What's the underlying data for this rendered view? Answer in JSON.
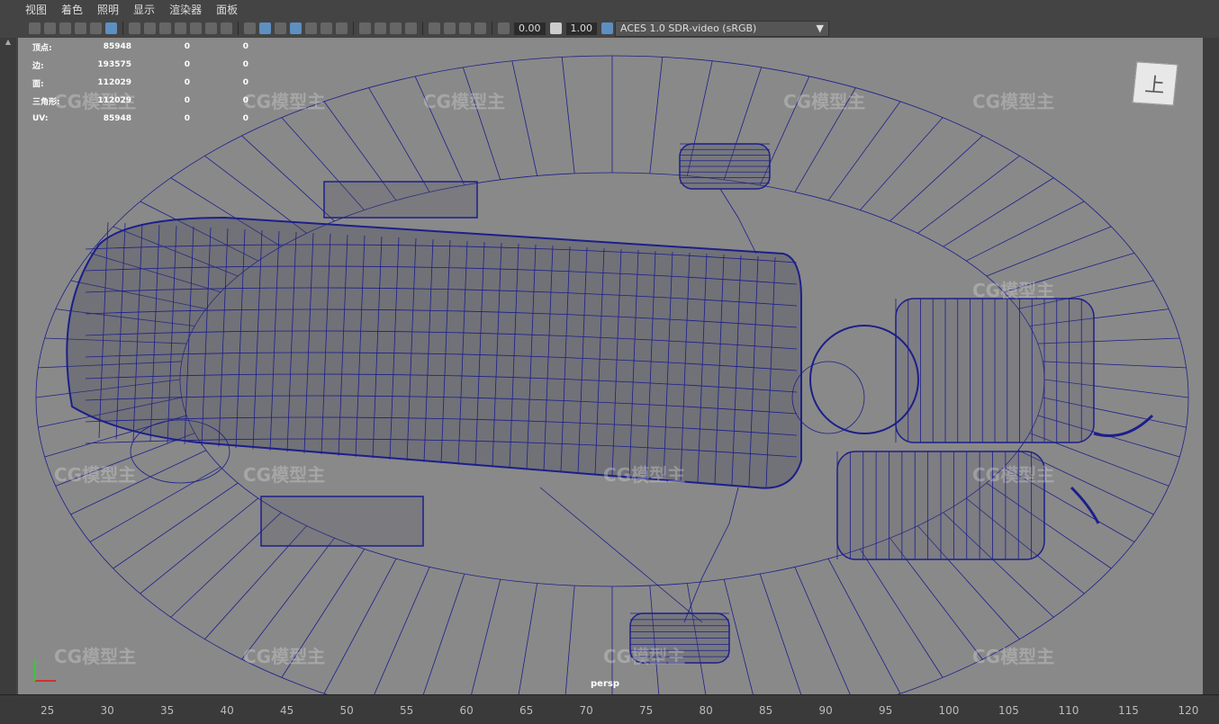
{
  "menu": [
    "视图",
    "着色",
    "照明",
    "显示",
    "渲染器",
    "面板"
  ],
  "toolbar": {
    "exposure": "0.00",
    "gamma": "1.00",
    "color_space": "ACES 1.0 SDR-video (sRGB)"
  },
  "hud": {
    "rows": [
      {
        "label": "顶点:",
        "v1": "85948",
        "v2": "0",
        "v3": "0"
      },
      {
        "label": "边:",
        "v1": "193575",
        "v2": "0",
        "v3": "0"
      },
      {
        "label": "面:",
        "v1": "112029",
        "v2": "0",
        "v3": "0"
      },
      {
        "label": "三角形:",
        "v1": "112029",
        "v2": "0",
        "v3": "0"
      },
      {
        "label": "UV:",
        "v1": "85948",
        "v2": "0",
        "v3": "0"
      }
    ]
  },
  "viewport": {
    "camera": "persp",
    "viewcube_face": "上",
    "watermark": "CG模型主"
  },
  "timeline": {
    "ticks": [
      "25",
      "30",
      "35",
      "40",
      "45",
      "50",
      "55",
      "60",
      "65",
      "70",
      "75",
      "80",
      "85",
      "90",
      "95",
      "100",
      "105",
      "110",
      "115",
      "120"
    ]
  },
  "colors": {
    "wire": "#1c1f8a",
    "viewport_bg": "#898989",
    "accent": "#5d8fbf"
  }
}
